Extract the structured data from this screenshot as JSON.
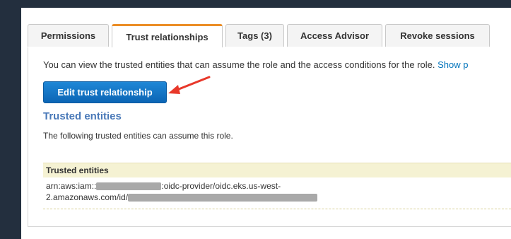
{
  "tabs": [
    {
      "label": "Permissions",
      "active": false
    },
    {
      "label": "Trust relationships",
      "active": true
    },
    {
      "label": "Tags (3)",
      "active": false
    },
    {
      "label": "Access Advisor",
      "active": false
    },
    {
      "label": "Revoke sessions",
      "active": false
    }
  ],
  "description": {
    "text": "You can view the trusted entities that can assume the role and the access conditions for the role. ",
    "link": "Show p"
  },
  "edit_button": {
    "label": "Edit trust relationship"
  },
  "trusted_entities": {
    "title": "Trusted entities",
    "subtitle": "The following trusted entities can assume this role.",
    "table_header": "Trusted entities",
    "row": {
      "prefix": "arn:aws:iam::",
      "middle": ":oidc-provider/oidc.eks.us-west-",
      "line2_prefix": "2.amazonaws.com/id/"
    }
  },
  "colors": {
    "accent_tab": "#eb8d25",
    "button_blue": "#0b65b5",
    "link_blue": "#0073bb",
    "arrow_red": "#e8382a",
    "header_yellow": "#f5f2d3"
  }
}
